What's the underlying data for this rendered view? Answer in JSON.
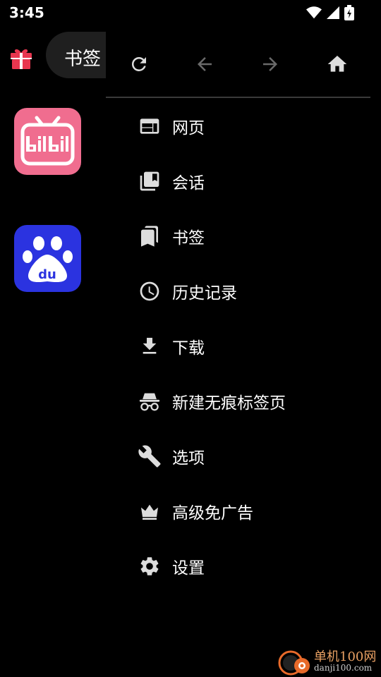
{
  "status": {
    "time": "3:45",
    "icons": [
      "wifi-icon",
      "cellular-signal-icon",
      "battery-charging-icon"
    ]
  },
  "tab": {
    "title": "书签"
  },
  "shortcuts": [
    {
      "icon": "bilibili-icon",
      "color": "#f06d8f"
    },
    {
      "icon": "baidu-icon",
      "color": "#2b33e0",
      "logo_text": "du"
    }
  ],
  "toolbar": {
    "buttons": [
      "refresh-icon",
      "back-arrow-icon",
      "forward-arrow-icon",
      "home-icon"
    ]
  },
  "menu": {
    "items": [
      {
        "label": "网页",
        "icon": "web-page-icon"
      },
      {
        "label": "会话",
        "icon": "session-icon"
      },
      {
        "label": "书签",
        "icon": "bookmarks-icon"
      },
      {
        "label": "历史记录",
        "icon": "history-icon"
      },
      {
        "label": "下载",
        "icon": "download-icon"
      },
      {
        "label": "新建无痕标签页",
        "icon": "incognito-icon"
      },
      {
        "label": "选项",
        "icon": "wrench-icon"
      },
      {
        "label": "高级免广告",
        "icon": "crown-icon"
      },
      {
        "label": "设置",
        "icon": "gear-icon"
      }
    ]
  },
  "watermark": {
    "title": "单机100网",
    "url": "danji100.com"
  },
  "colors": {
    "background": "#000000",
    "accent_gift": "#e8364f",
    "bili_pink": "#f06d8f",
    "baidu_blue": "#2b33e0"
  }
}
